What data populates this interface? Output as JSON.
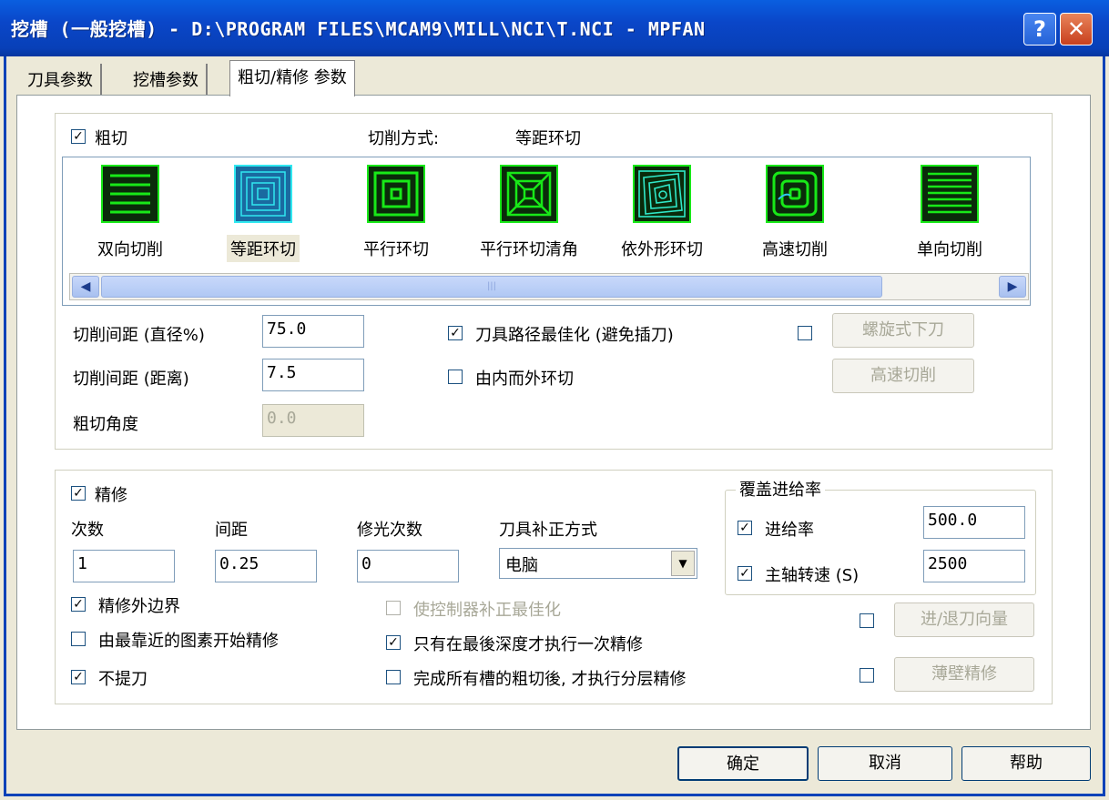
{
  "window": {
    "title": "挖槽 (一般挖槽) - D:\\PROGRAM FILES\\MCAM9\\MILL\\NCI\\T.NCI - MPFAN",
    "help_label": "?",
    "close_label": "✕"
  },
  "tabs": [
    {
      "label": "刀具参数"
    },
    {
      "label": "挖槽参数"
    },
    {
      "label": "粗切/精修 参数"
    }
  ],
  "rough": {
    "checkbox_label": "粗切",
    "checked": true,
    "method_label": "切削方式:",
    "method_value": "等距环切",
    "methods": [
      {
        "label": "双向切削",
        "icon": "zigzag-icon"
      },
      {
        "label": "等距环切",
        "icon": "constant-overlap-spiral-icon",
        "selected": true
      },
      {
        "label": "平行环切",
        "icon": "parallel-spiral-icon"
      },
      {
        "label": "平行环切清角",
        "icon": "parallel-spiral-clean-corners-icon"
      },
      {
        "label": "依外形环切",
        "icon": "morph-spiral-icon"
      },
      {
        "label": "高速切削",
        "icon": "high-speed-icon"
      },
      {
        "label": "单向切削",
        "icon": "one-way-icon"
      }
    ],
    "stepover_pct_label": "切削间距 (直径%)",
    "stepover_pct_value": "75.0",
    "stepover_dist_label": "切削间距 (距离)",
    "stepover_dist_value": "7.5",
    "angle_label": "粗切角度",
    "angle_value": "0.0",
    "minimize_plunge_label": "刀具路径最佳化 (避免插刀)",
    "minimize_plunge_checked": true,
    "inside_out_label": "由内而外环切",
    "inside_out_checked": false,
    "helix_button": "螺旋式下刀",
    "helix_checked": false,
    "highspeed_button": "高速切削"
  },
  "finish": {
    "checkbox_label": "精修",
    "checked": true,
    "passes_label": "次数",
    "passes_value": "1",
    "spacing_label": "间距",
    "spacing_value": "0.25",
    "spring_label": "修光次数",
    "spring_value": "0",
    "comp_label": "刀具补正方式",
    "comp_value": "电脑",
    "outer_label": "精修外边界",
    "outer_checked": true,
    "closest_label": "由最靠近的图素开始精修",
    "closest_checked": false,
    "keep_tool_down_label": "不提刀",
    "keep_tool_down_checked": true,
    "optimize_control_label": "使控制器补正最佳化",
    "optimize_control_checked": false,
    "final_depth_label": "只有在最後深度才执行一次精修",
    "final_depth_checked": true,
    "after_all_label": "完成所有槽的粗切後, 才执行分层精修",
    "after_all_checked": false,
    "leadinout_button": "进/退刀向量",
    "leadinout_checked": false,
    "thinwall_button": "薄壁精修",
    "thinwall_checked": false
  },
  "override": {
    "legend": "覆盖进给率",
    "feed_label": "进给率",
    "feed_checked": true,
    "feed_value": "500.0",
    "spindle_label": "主轴转速 (S)",
    "spindle_checked": true,
    "spindle_value": "2500"
  },
  "footer": {
    "ok": "确定",
    "cancel": "取消",
    "help": "帮助"
  },
  "colors": {
    "icon_bg": "#0a2a0a",
    "icon_line": "#18e818",
    "icon_selected_bg": "#1a6aa0",
    "icon_selected_line": "#30e8f0"
  }
}
